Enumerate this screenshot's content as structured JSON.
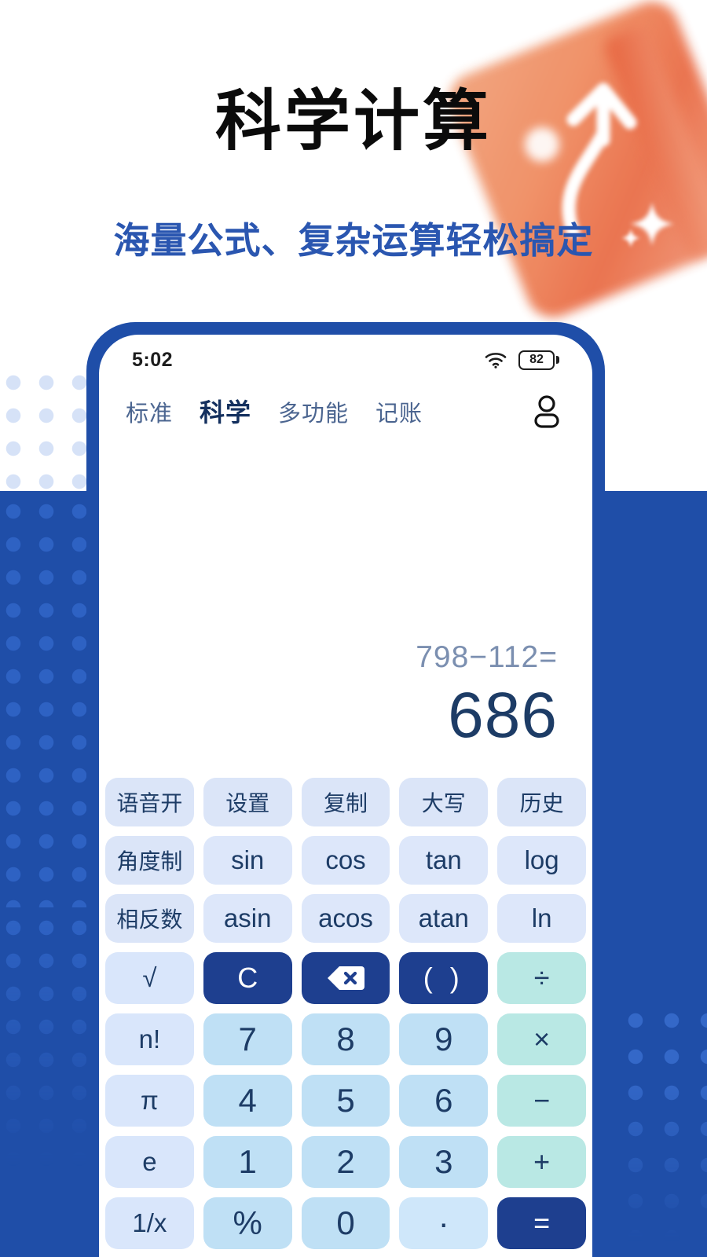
{
  "promo": {
    "headline": "科学计算",
    "subhead": "海量公式、复杂运算轻松搞定"
  },
  "colors": {
    "brand_blue": "#1f4ea8",
    "dark_key": "#1e3f8f",
    "digit_key": "#bfe0f5",
    "operator_key": "#b9e8e4",
    "function_key": "#dbe5f8",
    "headline": "#0b0b0b",
    "subhead": "#2a56b0",
    "result_text": "#1d3c66",
    "expression_text": "#7b8fb0",
    "deco_card": "#ef8a5e"
  },
  "phone": {
    "statusbar": {
      "time": "5:02",
      "wifi_icon": "wifi-icon",
      "battery_percent": "82"
    },
    "tabs": [
      {
        "label": "标准",
        "active": false
      },
      {
        "label": "科学",
        "active": true
      },
      {
        "label": "多功能",
        "active": false
      },
      {
        "label": "记账",
        "active": false
      }
    ],
    "account_icon": "account-icon",
    "display": {
      "expression": "798−112=",
      "result": "686"
    },
    "keypad": {
      "rows": [
        [
          {
            "label": "语音开",
            "style": "func"
          },
          {
            "label": "设置",
            "style": "func"
          },
          {
            "label": "复制",
            "style": "func"
          },
          {
            "label": "大写",
            "style": "func"
          },
          {
            "label": "历史",
            "style": "func"
          }
        ],
        [
          {
            "label": "角度制",
            "style": "func"
          },
          {
            "label": "sin",
            "style": "sci"
          },
          {
            "label": "cos",
            "style": "sci"
          },
          {
            "label": "tan",
            "style": "sci"
          },
          {
            "label": "log",
            "style": "sci"
          }
        ],
        [
          {
            "label": "相反数",
            "style": "func"
          },
          {
            "label": "asin",
            "style": "sci"
          },
          {
            "label": "acos",
            "style": "sci"
          },
          {
            "label": "atan",
            "style": "sci"
          },
          {
            "label": "ln",
            "style": "sci"
          }
        ],
        [
          {
            "label": "√",
            "style": "util",
            "icon": "sqrt-icon"
          },
          {
            "label": "C",
            "style": "dark"
          },
          {
            "label": "",
            "style": "dark",
            "icon": "backspace-icon"
          },
          {
            "label": "( )",
            "style": "dark"
          },
          {
            "label": "÷",
            "style": "op"
          }
        ],
        [
          {
            "label": "n!",
            "style": "util"
          },
          {
            "label": "7",
            "style": "digit"
          },
          {
            "label": "8",
            "style": "digit"
          },
          {
            "label": "9",
            "style": "digit"
          },
          {
            "label": "×",
            "style": "op"
          }
        ],
        [
          {
            "label": "π",
            "style": "util"
          },
          {
            "label": "4",
            "style": "digit"
          },
          {
            "label": "5",
            "style": "digit"
          },
          {
            "label": "6",
            "style": "digit"
          },
          {
            "label": "−",
            "style": "op"
          }
        ],
        [
          {
            "label": "e",
            "style": "util"
          },
          {
            "label": "1",
            "style": "digit"
          },
          {
            "label": "2",
            "style": "digit"
          },
          {
            "label": "3",
            "style": "digit"
          },
          {
            "label": "+",
            "style": "op"
          }
        ],
        [
          {
            "label": "1/x",
            "style": "util"
          },
          {
            "label": "%",
            "style": "digit"
          },
          {
            "label": "0",
            "style": "digit"
          },
          {
            "label": "·",
            "style": "dot"
          },
          {
            "label": "=",
            "style": "dark"
          }
        ]
      ]
    }
  }
}
